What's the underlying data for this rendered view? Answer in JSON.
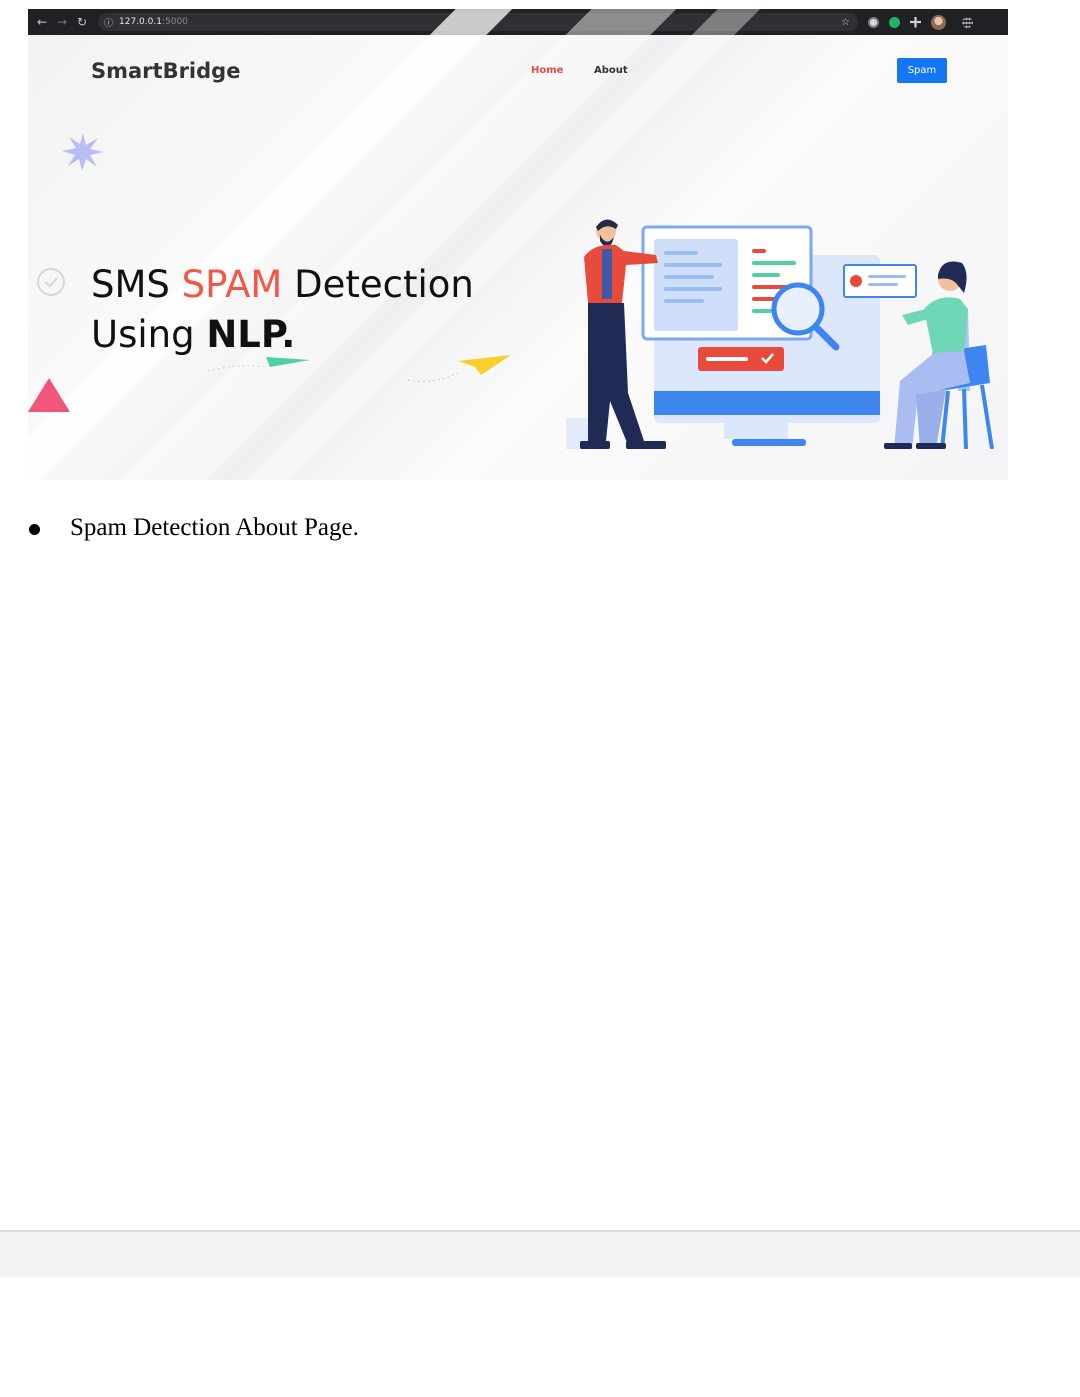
{
  "browser": {
    "url_host": "127.0.0.1",
    "url_port": ":5000",
    "back_icon": "arrow-left-icon",
    "forward_icon": "arrow-right-icon",
    "reload_icon": "reload-icon",
    "bookmark_icon": "star-icon"
  },
  "site": {
    "brand": "SmartBridge",
    "nav": {
      "home": "Home",
      "about": "About"
    },
    "cta": "Spam",
    "hero": {
      "line1_a": "SMS ",
      "line1_b": "SPAM",
      "line1_c": " Detection",
      "line2_a": "Using ",
      "line2_b": "NLP."
    },
    "colors": {
      "accent_red": "#f0584a",
      "button_blue": "#1377f4",
      "nav_active": "#e84a3c"
    }
  },
  "document": {
    "caption": "Spam Detection About Page."
  }
}
